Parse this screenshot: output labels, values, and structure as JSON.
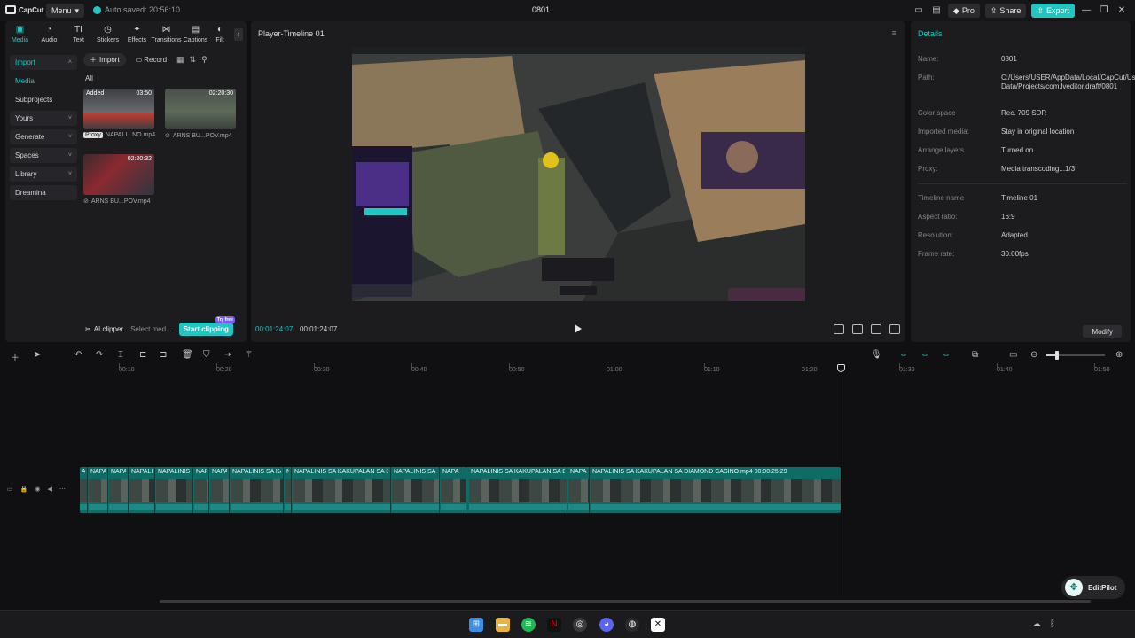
{
  "app": {
    "logo_text": "CapCut",
    "menu_label": "Menu",
    "autosave_text": "Auto saved: 20:56:10",
    "project_title": "0801",
    "pro_label": "Pro",
    "share_label": "Share",
    "export_label": "Export"
  },
  "left_panel": {
    "tabs": [
      {
        "label": "Media",
        "icon": "media-icon"
      },
      {
        "label": "Audio",
        "icon": "audio-icon"
      },
      {
        "label": "Text",
        "icon": "text-icon"
      },
      {
        "label": "Stickers",
        "icon": "stickers-icon"
      },
      {
        "label": "Effects",
        "icon": "effects-icon"
      },
      {
        "label": "Transitions",
        "icon": "transitions-icon"
      },
      {
        "label": "Captions",
        "icon": "captions-icon"
      },
      {
        "label": "Filt",
        "icon": "filters-icon"
      }
    ],
    "nav": [
      {
        "label": "Import"
      },
      {
        "label": "Media"
      },
      {
        "label": "Subprojects"
      },
      {
        "label": "Yours"
      },
      {
        "label": "Generate",
        "badge": "AI"
      },
      {
        "label": "Spaces"
      },
      {
        "label": "Library"
      },
      {
        "label": "Dreamina"
      }
    ],
    "import_button": "Import",
    "record_button": "Record",
    "filter_label": "All",
    "media": [
      {
        "tag": "Added",
        "duration": "03:50",
        "name": "NAPALI...NO.mp4",
        "proxy": "Proxy"
      },
      {
        "tag": "",
        "duration": "02:20:30",
        "name": "ARNS BU...POV.mp4",
        "proxy": ""
      },
      {
        "tag": "",
        "duration": "02:20:32",
        "name": "ARNS BU...POV.mp4",
        "proxy": ""
      }
    ],
    "ai_clipper_label": "AI clipper",
    "select_media_text": "Select med...",
    "start_clipping": "Start clipping",
    "free_badge": "Try free"
  },
  "player": {
    "title": "Player-Timeline 01",
    "current_time": "00:01:24:07",
    "total_time": "00:01:24:07"
  },
  "details": {
    "title": "Details",
    "rows": [
      {
        "key": "Name:",
        "value": "0801"
      },
      {
        "key": "Path:",
        "value": "C:/Users/USER/AppData/Local/CapCut/User Data/Projects/com.lveditor.draft/0801"
      },
      {
        "key": "Color space",
        "value": "Rec. 709 SDR"
      },
      {
        "key": "Imported media:",
        "value": "Stay in original location"
      },
      {
        "key": "Arrange layers",
        "value": "Turned on"
      },
      {
        "key": "Proxy:",
        "value": "Media transcoding...1/3"
      },
      {
        "key": "Timeline name",
        "value": "Timeline 01"
      },
      {
        "key": "Aspect ratio:",
        "value": "16:9"
      },
      {
        "key": "Resolution:",
        "value": "Adapted"
      },
      {
        "key": "Frame rate:",
        "value": "30.00fps"
      }
    ],
    "modify_button": "Modify"
  },
  "timeline": {
    "ruler": [
      "00:10",
      "00:20",
      "00:30",
      "00:40",
      "00:50",
      "01:00",
      "01:10",
      "01:20",
      "01:30",
      "01:40",
      "01:50"
    ],
    "clips": [
      {
        "name": "AP"
      },
      {
        "name": "NAPA"
      },
      {
        "name": "NAPA"
      },
      {
        "name": "NAPALIN"
      },
      {
        "name": "NAPALINIS"
      },
      {
        "name": "NAP"
      },
      {
        "name": "NAPA"
      },
      {
        "name": "NAPALINIS SA KA"
      },
      {
        "name": "N"
      },
      {
        "name": "NAPALINIS SA KAKUPALAN SA DIA"
      },
      {
        "name": "NAPALINIS SA K"
      },
      {
        "name": "NAPA"
      },
      {
        "name": "NAPALINIS SA KAKUPALAN SA DIA"
      },
      {
        "name": "NAPA"
      },
      {
        "name": "NAPALINIS SA KAKUPALAN SA DIAMOND CASINO.mp4   00:00:25:29"
      }
    ]
  },
  "editpilot_label": "EditPilot"
}
